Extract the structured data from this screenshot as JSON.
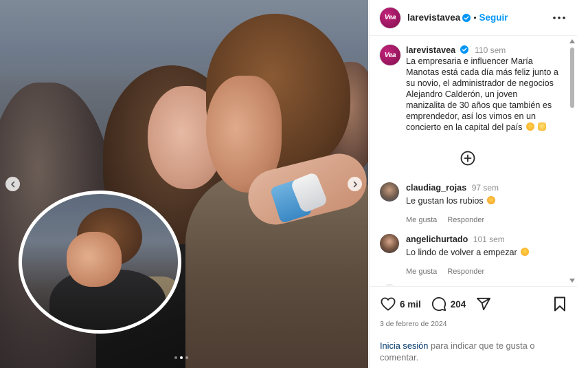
{
  "account": {
    "avatar_text": "Vea",
    "username": "larevistavea",
    "separator": "•",
    "follow_label": "Seguir"
  },
  "caption": {
    "username": "larevistavea",
    "time": "110 sem",
    "text": "La empresaria e influencer María Manotas está cada día más feliz junto a su novio, el administrador de negocios Alejandro Calderón, un joven manizalita de 30 años que también es emprendedor, así los vimos en un concierto en la capital del país"
  },
  "comments": [
    {
      "username": "claudiag_rojas",
      "time": "97 sem",
      "text": "Le gustan los rubios",
      "like_label": "Me gusta",
      "reply_label": "Responder"
    },
    {
      "username": "angelichurtado",
      "time": "101 sem",
      "text": "Lo lindo de volver a empezar",
      "like_label": "Me gusta",
      "reply_label": "Responder"
    }
  ],
  "stats": {
    "likes": "6 mil",
    "comments": "204",
    "date": "3 de febrero de 2024"
  },
  "login_prompt": {
    "link": "Inicia sesión",
    "text": " para indicar que te gusta o comentar."
  },
  "carousel": {
    "slides": 3,
    "active_index": 1
  },
  "icons": {
    "verified": "verified-badge-icon",
    "more": "more-options-icon",
    "add": "plus-circle-icon",
    "like": "heart-icon",
    "comment": "comment-icon",
    "share": "send-icon",
    "save": "bookmark-icon",
    "prev": "chevron-left-icon",
    "next": "chevron-right-icon"
  },
  "colors": {
    "link_blue": "#0095f6",
    "brand_magenta": "#a3165f",
    "text_dark": "#262626",
    "text_muted": "#737373"
  }
}
